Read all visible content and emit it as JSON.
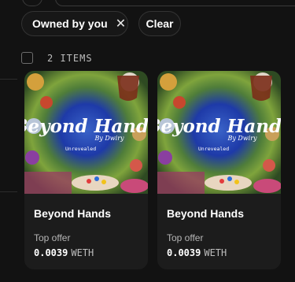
{
  "filters": {
    "chips": [
      {
        "label": "Owned by you",
        "remove_icon": "close-icon"
      },
      {
        "label": "Clear"
      }
    ]
  },
  "results": {
    "count_label": "2 ITEMS"
  },
  "items": [
    {
      "name": "Beyond Hands",
      "art_title": "Beyond Hands",
      "art_byline": "By Dwiry",
      "art_subtitle": "Unrevealed",
      "offer_label": "Top offer",
      "offer_price": "0.0039",
      "offer_currency": "WETH"
    },
    {
      "name": "Beyond Hands",
      "art_title": "Beyond Hands",
      "art_byline": "By Dwiry",
      "art_subtitle": "Unrevealed",
      "offer_label": "Top offer",
      "offer_price": "0.0039",
      "offer_currency": "WETH"
    }
  ]
}
